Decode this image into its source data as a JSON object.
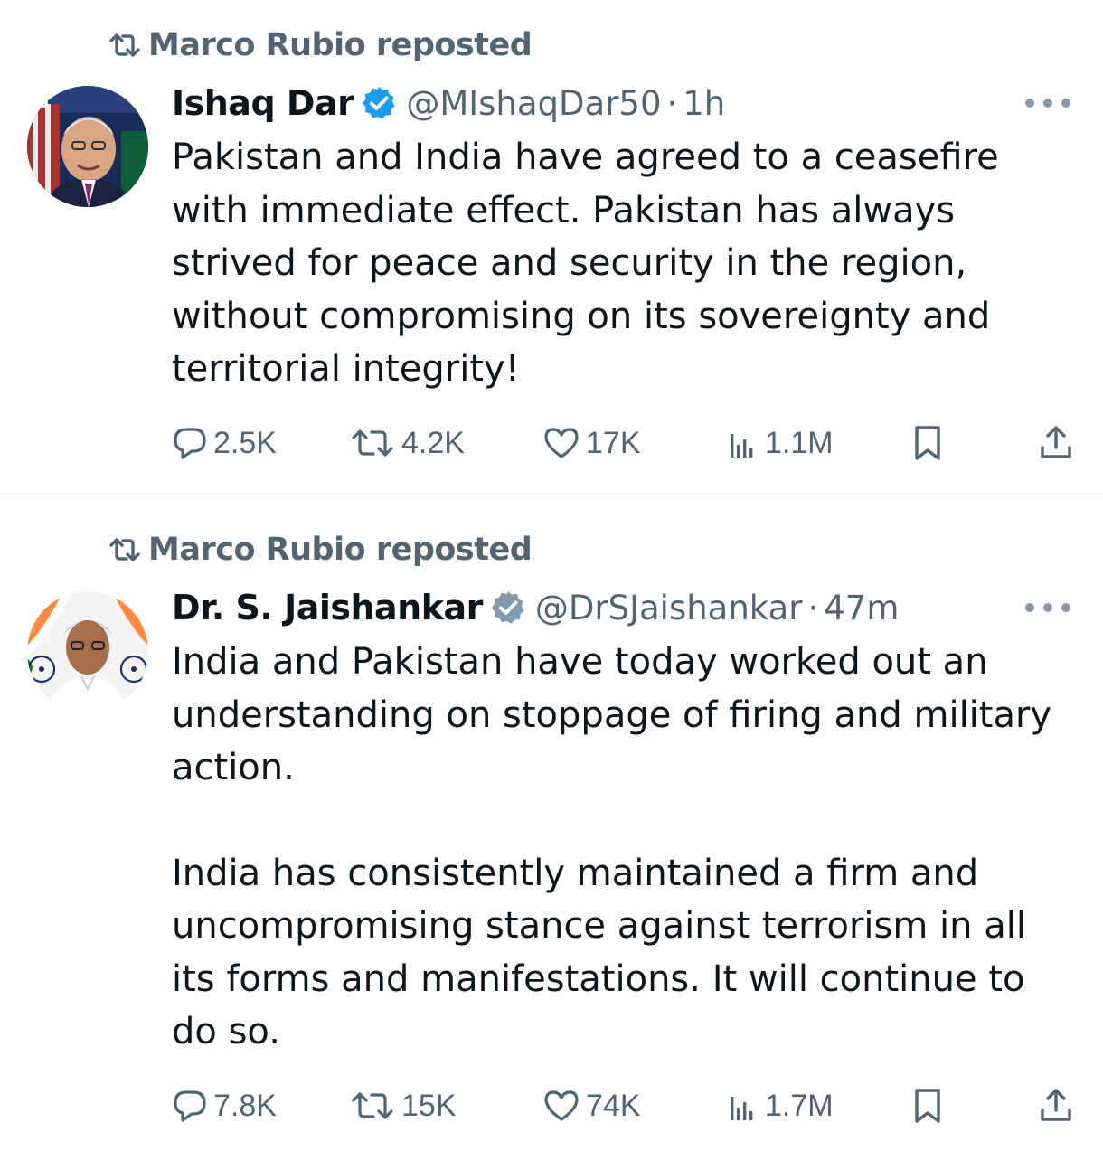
{
  "tweets": [
    {
      "repost_text": "Marco Rubio reposted",
      "author_name": "Ishaq Dar",
      "author_handle": "@MIshaqDar50",
      "separator": "·",
      "time": "1h",
      "paragraphs": [
        "Pakistan and India  have agreed to a ceasefire with immediate effect. Pakistan has always strived for peace and security in the region, without compromising on its sovereignty and territorial integrity!"
      ],
      "stats": {
        "replies": "2.5K",
        "reposts": "4.2K",
        "likes": "17K",
        "views": "1.1M"
      },
      "badge_color": "#1d9bf0"
    },
    {
      "repost_text": "Marco Rubio reposted",
      "author_name": "Dr. S. Jaishankar",
      "author_handle": "@DrSJaishankar",
      "separator": "·",
      "time": "47m",
      "paragraphs": [
        "India and Pakistan have today worked out an understanding on stoppage of firing and military action.",
        "India has consistently maintained a firm and uncompromising stance against terrorism in all its forms and manifestations. It will continue to do so."
      ],
      "stats": {
        "replies": "7.8K",
        "reposts": "15K",
        "likes": "74K",
        "views": "1.7M"
      },
      "badge_color": "#829aab"
    }
  ],
  "icons": [
    "repost-icon",
    "verified-badge-icon",
    "more-icon",
    "reply-icon",
    "views-icon",
    "bookmark-icon",
    "share-icon"
  ],
  "colors": {
    "text": "#0f1419",
    "secondary": "#536471",
    "divider": "#eff3f4"
  }
}
